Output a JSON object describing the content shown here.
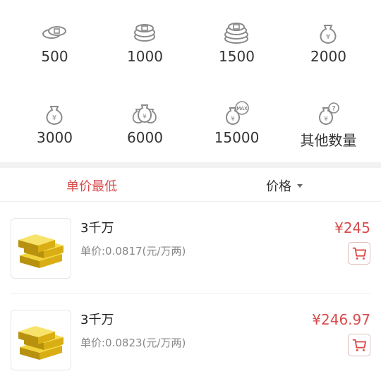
{
  "amount_options": [
    {
      "label": "500",
      "icon": "coins-small-icon"
    },
    {
      "label": "1000",
      "icon": "coins-stack-icon"
    },
    {
      "label": "1500",
      "icon": "coins-pile-icon"
    },
    {
      "label": "2000",
      "icon": "money-bag-icon"
    },
    {
      "label": "3000",
      "icon": "money-bag-icon"
    },
    {
      "label": "6000",
      "icon": "money-bags-icon"
    },
    {
      "label": "15000",
      "icon": "money-bag-max-icon"
    },
    {
      "label": "其他数量",
      "icon": "money-bag-question-icon"
    }
  ],
  "sort": {
    "lowest_unit_price": "单价最低",
    "price": "价格"
  },
  "listings": [
    {
      "title": "3千万",
      "unit_price": "单价:0.0817(元/万两)",
      "price": "¥245",
      "icon": "gold-bars-icon"
    },
    {
      "title": "3千万",
      "unit_price": "单价:0.0823(元/万两)",
      "price": "¥246.97",
      "icon": "gold-bars-icon"
    }
  ],
  "colors": {
    "accent": "#d94b4b",
    "icon_gray": "#9a9a9a",
    "gold": "#e8c22c"
  }
}
